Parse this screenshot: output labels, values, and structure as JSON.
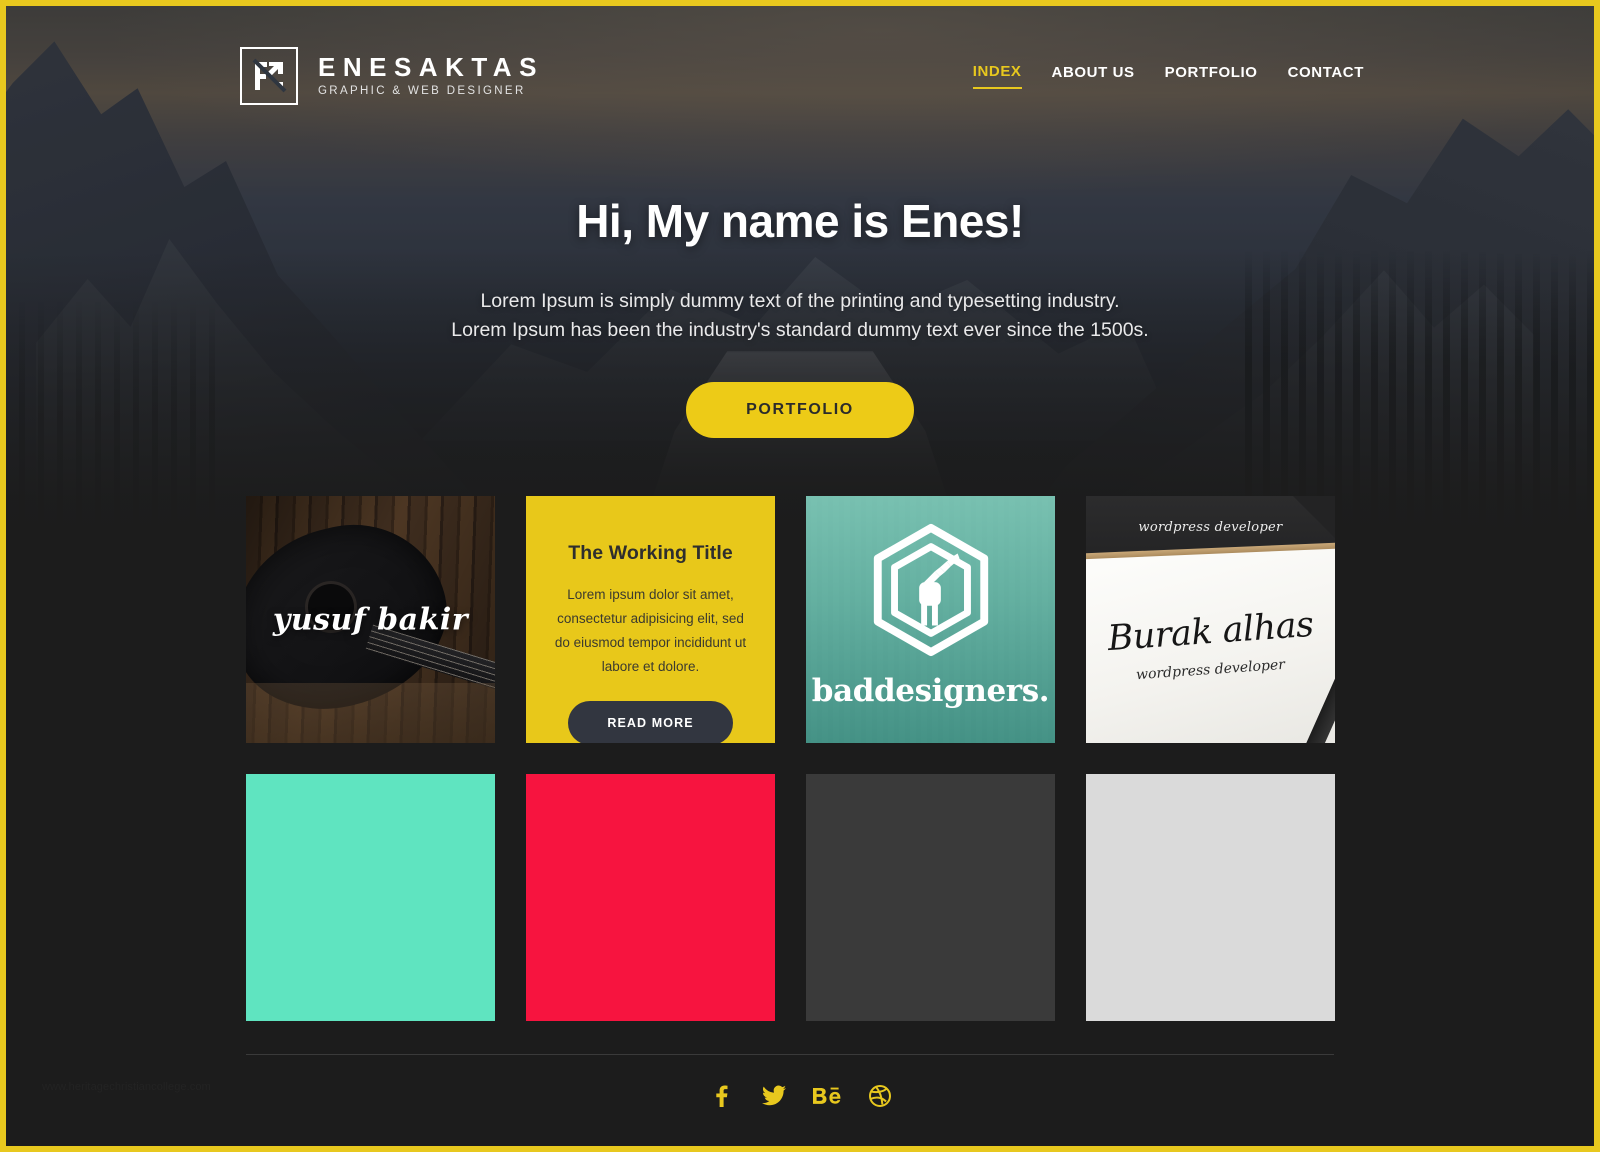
{
  "theme": {
    "accent_yellow": "#E8C81E",
    "page_bg": "#1C1C1C",
    "border_color": "#E8C81E",
    "dark_button": "#323640"
  },
  "header": {
    "brand_name": "ENESAKTAS",
    "brand_tagline": "GRAPHIC & WEB DESIGNER",
    "logo_icon": "enesaktas-monogram-icon",
    "nav": [
      {
        "label": "INDEX",
        "active": true
      },
      {
        "label": "ABOUT US",
        "active": false
      },
      {
        "label": "PORTFOLIO",
        "active": false
      },
      {
        "label": "CONTACT",
        "active": false
      }
    ]
  },
  "hero": {
    "title": "Hi, My name is Enes!",
    "subtitle_line1": "Lorem Ipsum is simply dummy text of the printing and typesetting industry.",
    "subtitle_line2": "Lorem Ipsum has been the industry's standard dummy text ever since the 1500s.",
    "cta_label": "PORTFOLIO"
  },
  "cards": {
    "guitar": {
      "name": "yusuf bakir",
      "type": "photo-logo"
    },
    "working_title": {
      "title": "The Working Title",
      "body": "Lorem ipsum dolor sit amet, consectetur adipisicing elit, sed do eiusmod tempor incididunt ut labore et dolore.",
      "button_label": "READ MORE",
      "background": "#E8C81A"
    },
    "baddesigners": {
      "wordmark": "baddesigners.",
      "logo_icon": "hexagon-fist-pencil-icon",
      "background": "#6EBCA8"
    },
    "burak": {
      "top_text": "wordpress developer",
      "name": "Burak alhas",
      "role": "wordpress developer"
    },
    "color_tiles": [
      {
        "label": "mint",
        "color": "#5FE4C0"
      },
      {
        "label": "red",
        "color": "#F7143F"
      },
      {
        "label": "dark-gray",
        "color": "#3A3A3A"
      },
      {
        "label": "light-gray",
        "color": "#DADADA"
      }
    ]
  },
  "footer": {
    "socials": [
      {
        "name": "facebook",
        "glyph": "f"
      },
      {
        "name": "twitter",
        "glyph": "t"
      },
      {
        "name": "behance",
        "glyph": "Be"
      },
      {
        "name": "dribbble",
        "glyph": "d"
      }
    ],
    "watermark": "www.heritagechristiancollege.com"
  }
}
